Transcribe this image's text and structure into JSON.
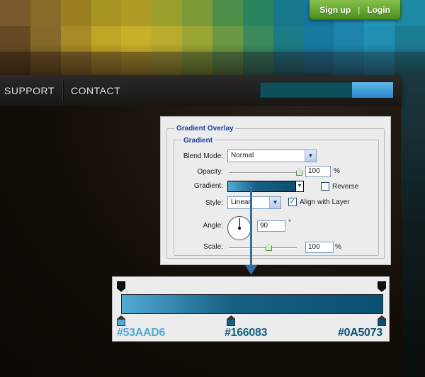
{
  "header": {
    "auth": {
      "signup_label": "Sign up",
      "separator": "|",
      "login_label": "Login"
    },
    "mosaic_colors": [
      [
        "#7a5a2c",
        "#8a6a28",
        "#9c7e22",
        "#a89422",
        "#b09a26",
        "#9aa02c",
        "#7c9a36",
        "#4e8e4a",
        "#2a8460",
        "#16788a",
        "#1676a0",
        "#1a86ae",
        "#2296b8",
        "#1f8aa4"
      ],
      [
        "#664a24",
        "#86682a",
        "#a88a26",
        "#c0a624",
        "#c8b02a",
        "#b8ac2e",
        "#9aa634",
        "#6a9844",
        "#3a8a5e",
        "#1c7c86",
        "#1878a0",
        "#1c84ac",
        "#2090b4",
        "#1c7c94"
      ],
      [
        "#4a3418",
        "#5e4620",
        "#725a24",
        "#826a26",
        "#8a7228",
        "#80782c",
        "#687830",
        "#4a6e3c",
        "#2e6050",
        "#1e5866",
        "#1c5a78",
        "#1e6684",
        "#206e8a",
        "#1a5e72"
      ]
    ]
  },
  "nav": {
    "items": [
      "SUPPORT",
      "CONTACT"
    ]
  },
  "ps_panel": {
    "outer_title": "Gradient Overlay",
    "inner_title": "Gradient",
    "blend_mode": {
      "label": "Blend Mode:",
      "value": "Normal"
    },
    "opacity": {
      "label": "Opacity:",
      "value": "100",
      "unit": "%",
      "fraction": 1.0
    },
    "gradient": {
      "label": "Gradient:",
      "reverse_label": "Reverse",
      "reverse_checked": false
    },
    "style": {
      "label": "Style:",
      "value": "Linear",
      "align_label": "Align with Layer",
      "align_checked": true
    },
    "angle": {
      "label": "Angle:",
      "value": "90",
      "unit": "°"
    },
    "scale": {
      "label": "Scale:",
      "value": "100",
      "unit": "%",
      "fraction": 0.6
    }
  },
  "gradient_editor": {
    "stops": [
      {
        "hex": "#53AAD6",
        "label": "#53AAD6",
        "position": 0.0
      },
      {
        "hex": "#166083",
        "label": "#166083",
        "position": 0.42
      },
      {
        "hex": "#0A5073",
        "label": "#0A5073",
        "position": 1.0
      }
    ],
    "label_colors": [
      "#53AAD6",
      "#166083",
      "#0A5073"
    ]
  }
}
